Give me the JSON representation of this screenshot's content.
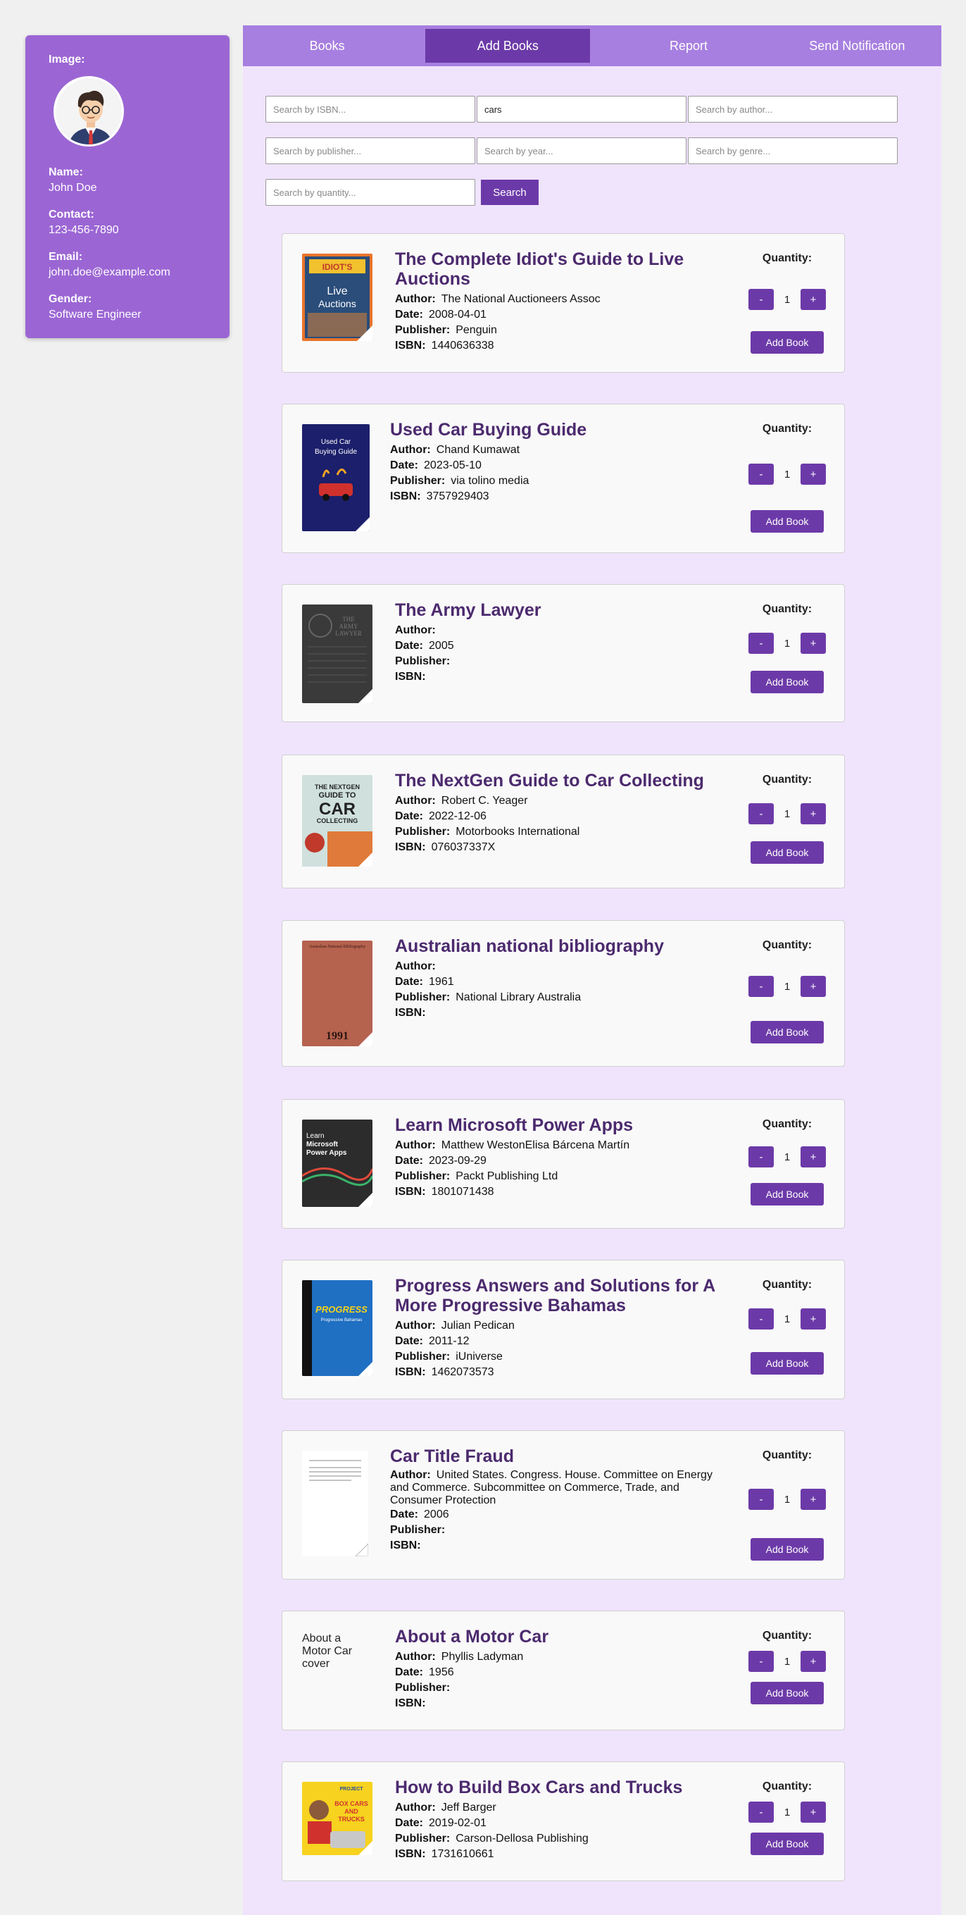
{
  "profile": {
    "image_label": "Image:",
    "name_label": "Name:",
    "name": "John Doe",
    "contact_label": "Contact:",
    "contact": "123-456-7890",
    "email_label": "Email:",
    "email": "john.doe@example.com",
    "gender_label": "Gender:",
    "gender": "Software Engineer"
  },
  "nav": {
    "books": "Books",
    "add_books": "Add Books",
    "report": "Report",
    "send_notification": "Send Notification"
  },
  "search": {
    "isbn_placeholder": "Search by ISBN...",
    "title_value": "cars",
    "author_placeholder": "Search by author...",
    "publisher_placeholder": "Search by publisher...",
    "year_placeholder": "Search by year...",
    "genre_placeholder": "Search by genre...",
    "quantity_placeholder": "Search by quantity...",
    "button": "Search"
  },
  "labels": {
    "author": "Author:",
    "date": "Date:",
    "publisher": "Publisher:",
    "isbn": "ISBN:",
    "quantity": "Quantity:",
    "minus": "-",
    "plus": "+",
    "add_book": "Add Book"
  },
  "books": [
    {
      "title": "The Complete Idiot's Guide to Live Auctions",
      "author": "The National Auctioneers Assoc",
      "date": "2008-04-01",
      "publisher": "Penguin",
      "isbn": "1440636338",
      "qty": "1"
    },
    {
      "title": "Used Car Buying Guide",
      "author": "Chand Kumawat",
      "date": "2023-05-10",
      "publisher": "via tolino media",
      "isbn": "3757929403",
      "qty": "1"
    },
    {
      "title": "The Army Lawyer",
      "author": "",
      "date": "2005",
      "publisher": "",
      "isbn": "",
      "qty": "1"
    },
    {
      "title": "The NextGen Guide to Car Collecting",
      "author": "Robert C. Yeager",
      "date": "2022-12-06",
      "publisher": "Motorbooks International",
      "isbn": "076037337X",
      "qty": "1"
    },
    {
      "title": "Australian national bibliography",
      "author": "",
      "date": "1961",
      "publisher": "National Library Australia",
      "isbn": "",
      "qty": "1"
    },
    {
      "title": "Learn Microsoft Power Apps",
      "author": "Matthew WestonElisa Bárcena Martín",
      "date": "2023-09-29",
      "publisher": "Packt Publishing Ltd",
      "isbn": "1801071438",
      "qty": "1"
    },
    {
      "title": "Progress Answers and Solutions for A More Progressive Bahamas",
      "author": "Julian Pedican",
      "date": "2011-12",
      "publisher": "iUniverse",
      "isbn": "1462073573",
      "qty": "1"
    },
    {
      "title": "Car Title Fraud",
      "author": "United States. Congress. House. Committee on Energy and Commerce. Subcommittee on Commerce, Trade, and Consumer Protection",
      "date": "2006",
      "publisher": "",
      "isbn": "",
      "qty": "1"
    },
    {
      "title": "About a Motor Car",
      "author": "Phyllis Ladyman",
      "date": "1956",
      "publisher": "",
      "isbn": "",
      "qty": "1",
      "cover_alt": "About a Motor Car cover"
    },
    {
      "title": "How to Build Box Cars and Trucks",
      "author": "Jeff Barger",
      "date": "2019-02-01",
      "publisher": "Carson-Dellosa Publishing",
      "isbn": "1731610661",
      "qty": "1"
    }
  ],
  "covers": {
    "b0": {
      "line1": "IDIOT'S",
      "line2": "Live",
      "line3": "Auctions"
    },
    "b1": {
      "line1": "Used Car",
      "line2": "Buying Guide"
    },
    "b2": {
      "line1": "THE",
      "line2": "ARMY",
      "line3": "LAWYER"
    },
    "b3": {
      "line1": "THE NEXTGEN",
      "line2": "GUIDE TO",
      "line3": "CAR",
      "line4": "COLLECTING"
    },
    "b4": {
      "line1": "Australian National Bibliography",
      "line2": "1991"
    },
    "b5": {
      "line1": "Learn",
      "line2": "Microsoft",
      "line3": "Power Apps"
    },
    "b6": {
      "line1": "PROGRESS",
      "line2": "Progressive Bahamas"
    },
    "b9": {
      "line1": "PROJECT",
      "line2": "BOX CARS",
      "line3": "AND",
      "line4": "TRUCKS"
    }
  }
}
